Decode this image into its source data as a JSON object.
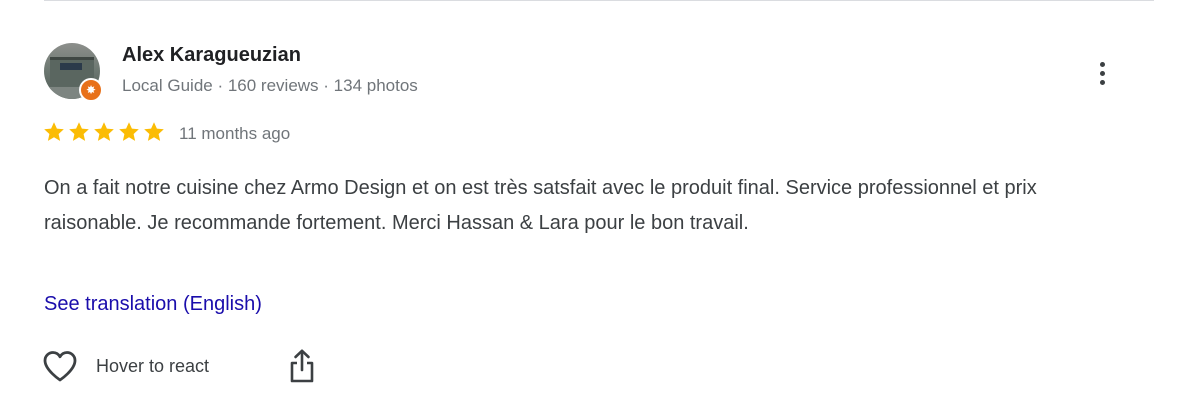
{
  "review": {
    "author": {
      "name": "Alex Karagueuzian",
      "meta": "Local Guide · 160 reviews · 134 photos",
      "badge_icon": "local-guide-star-icon",
      "badge_color": "#e8711a"
    },
    "rating": 5,
    "rating_max": 5,
    "star_color": "#fbbc04",
    "date": "11 months ago",
    "text": "On a fait notre cuisine chez Armo Design et on est très satsfait avec le produit final. Service professionnel et prix raisonable. Je recommande fortement. Merci Hassan & Lara pour le bon travail.",
    "translate_link": "See translation (English)",
    "link_color": "#1a0dab",
    "actions": {
      "react_label": "Hover to react",
      "react_icon": "heart-icon",
      "share_icon": "share-icon",
      "more_icon": "more-vertical-icon"
    }
  }
}
